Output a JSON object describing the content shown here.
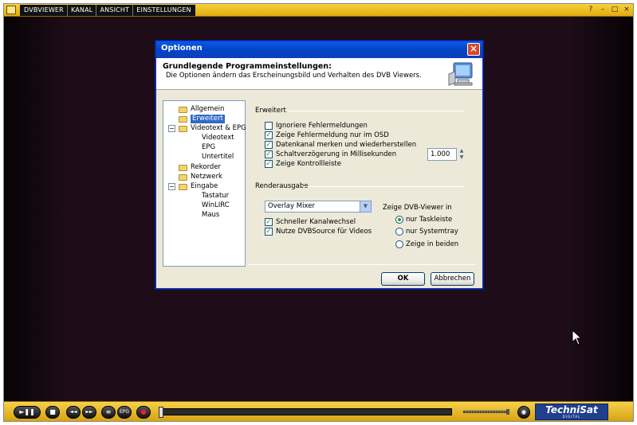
{
  "topbar": {
    "menus": [
      "DVBVIEWER",
      "KANAL",
      "ANSICHT",
      "EINSTELLUNGEN"
    ],
    "window_buttons": [
      "?",
      "–",
      "□",
      "×"
    ]
  },
  "dialog": {
    "title": "Optionen",
    "close_glyph": "×",
    "header_title": "Grundlegende Programmeinstellungen:",
    "header_subtitle": "Die Optionen ändern das Erscheinungsbild und Verhalten des DVB Viewers.",
    "tree": {
      "allgemein": "Allgemein",
      "erweitert": "Erweitert",
      "videotext_epg": "Videotext & EPG",
      "videotext": "Videotext",
      "epg": "EPG",
      "untertitel": "Untertitel",
      "rekorder": "Rekorder",
      "netzwerk": "Netzwerk",
      "eingabe": "Eingabe",
      "tastatur": "Tastatur",
      "winlirc": "WinLIRC",
      "maus": "Maus",
      "minus": "−"
    },
    "group_erweitert": "Erweitert",
    "checkboxes": {
      "ignore_errors": {
        "label": "Ignoriere Fehlermeldungen",
        "mark": ""
      },
      "errors_osd": {
        "label": "Zeige Fehlermeldung nur im OSD",
        "mark": "✓"
      },
      "datachannel": {
        "label": "Datenkanal merken und wiederherstellen",
        "mark": "✓"
      },
      "switch_delay": {
        "label": "Schaltverzögerung in Millisekunden",
        "mark": "✓"
      },
      "control_bar": {
        "label": "Zeige Kontrollleiste",
        "mark": "✓"
      },
      "fast_switch": {
        "label": "Schneller Kanalwechsel",
        "mark": "✓"
      },
      "dvbsource": {
        "label": "Nutze DVBSource für Videos",
        "mark": "✓"
      }
    },
    "delay_value": "1.000",
    "spin_up": "▲",
    "spin_down": "▼",
    "group_render": "Renderausgabe",
    "renderer_selected": "Overlay Mixer",
    "select_arrow": "▼",
    "show_in_label": "Zeige DVB-Viewer in",
    "radios": {
      "taskbar": "nur Taskleiste",
      "systray": "nur Systemtray",
      "both": "Zeige in beiden"
    },
    "ok_label": "OK",
    "cancel_label": "Abbrechen"
  },
  "controls": {
    "play_pause": "►❚❚",
    "stop": "■",
    "prev": "◄◄",
    "next": "►►",
    "list": "≡",
    "epg": "EPG",
    "record": "●",
    "mute": "◉"
  },
  "logo": {
    "main": "TechniSat",
    "sub": "DIGITAL"
  },
  "colors": {
    "accent": "#f2c021",
    "dialog_title": "#0a5ae8",
    "selection": "#316ac5",
    "check": "#21a121"
  }
}
